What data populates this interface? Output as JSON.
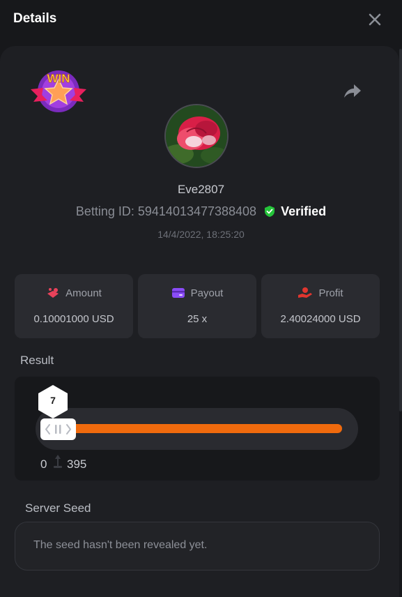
{
  "header": {
    "title": "Details",
    "close_icon": "close-icon"
  },
  "badge": {
    "text": "WIN",
    "icon": "win-star-badge-icon"
  },
  "share_icon": "share-icon",
  "user": {
    "name": "Eve2807",
    "avatar": "rose-avatar"
  },
  "bet": {
    "id_label": "Betting ID: 59414013477388408",
    "verified_label": "Verified",
    "datetime": "14/4/2022, 18:25:20"
  },
  "stats": [
    {
      "label": "Amount",
      "value": "0.10001000 USD",
      "icon": "amount-coins-icon",
      "color": "#e8425a"
    },
    {
      "label": "Payout",
      "value": "25 x",
      "icon": "payout-wallet-icon",
      "color": "#8a4cf7"
    },
    {
      "label": "Profit",
      "value": "2.40024000 USD",
      "icon": "profit-hand-icon",
      "color": "#e0362f"
    }
  ],
  "result": {
    "label": "Result",
    "roll": "7",
    "range_min": "0",
    "range_max": "395",
    "bar_color": "#f06a0d"
  },
  "server_seed": {
    "label": "Server Seed",
    "value": "The seed hasn't been revealed yet."
  }
}
